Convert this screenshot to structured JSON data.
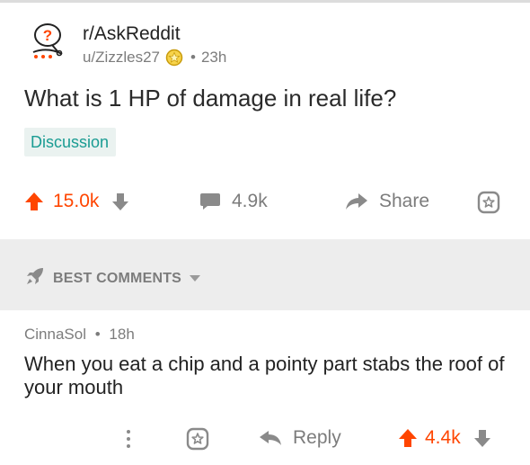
{
  "post": {
    "subreddit": "r/AskReddit",
    "author": "u/Zizzles27",
    "separator": "•",
    "age": "23h",
    "title": "What is 1 HP of damage in real life?",
    "flair": "Discussion",
    "upvotes": "15.0k",
    "comments": "4.9k",
    "share_label": "Share"
  },
  "sort": {
    "label": "BEST COMMENTS"
  },
  "comment": {
    "author": "CinnaSol",
    "separator": "•",
    "age": "18h",
    "body": "When you eat a chip and a pointy part stabs the roof of your mouth",
    "reply_label": "Reply",
    "upvotes": "4.4k"
  },
  "colors": {
    "upvote": "#ff4500",
    "flair_text": "#1a9c93",
    "flair_bg": "#eaf2f0",
    "muted": "#7c7c7c",
    "sort_bar_bg": "#ededed"
  },
  "icons": {
    "subreddit": "askreddit-snoo-icon",
    "award": "gold-award-icon",
    "upvote": "upvote-arrow-icon",
    "downvote": "downvote-arrow-icon",
    "comment": "comment-bubble-icon",
    "share": "share-arrow-icon",
    "save": "star-icon",
    "sort": "rocket-icon",
    "more": "more-vertical-icon",
    "reply": "reply-arrow-icon"
  }
}
